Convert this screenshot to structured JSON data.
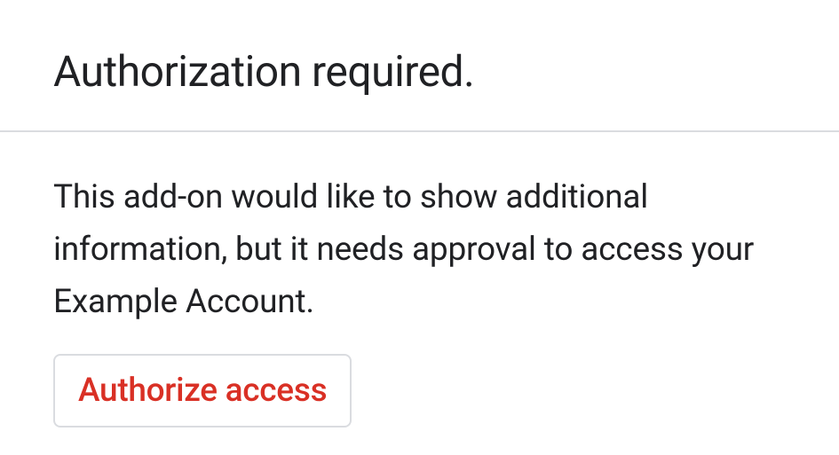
{
  "header": {
    "title": "Authorization required."
  },
  "body": {
    "description": "This add-on would like to show additional information, but it needs approval to access your Example Account."
  },
  "actions": {
    "authorize_label": "Authorize access"
  }
}
